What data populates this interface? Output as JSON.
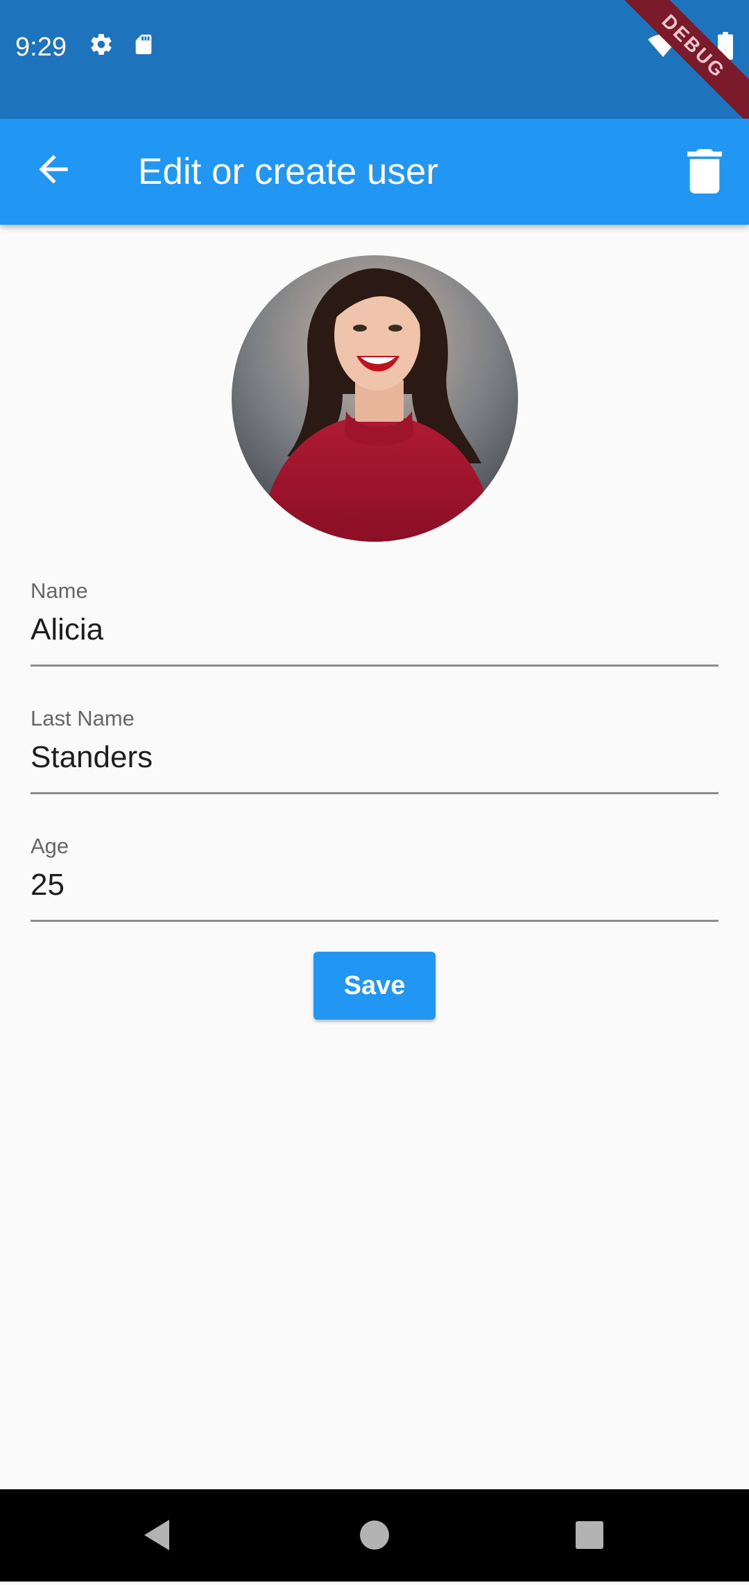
{
  "status_bar": {
    "time": "9:29",
    "icons": [
      "gear-icon",
      "sd-card-icon",
      "wifi-icon",
      "signal-icon",
      "battery-icon"
    ],
    "debug_banner": "DEBUG"
  },
  "app_bar": {
    "title": "Edit or create user",
    "back_icon": "arrow-back-icon",
    "delete_icon": "trash-icon",
    "color": "#2196f3"
  },
  "form": {
    "name": {
      "label": "Name",
      "value": "Alicia"
    },
    "last_name": {
      "label": "Last Name",
      "value": "Standers"
    },
    "age": {
      "label": "Age",
      "value": "25"
    },
    "save_label": "Save"
  },
  "nav_bar": {
    "icons": [
      "back-triangle-icon",
      "home-circle-icon",
      "recents-square-icon"
    ]
  },
  "colors": {
    "status_bar": "#1e73bd",
    "primary": "#2196f3",
    "background": "#fafafa"
  }
}
